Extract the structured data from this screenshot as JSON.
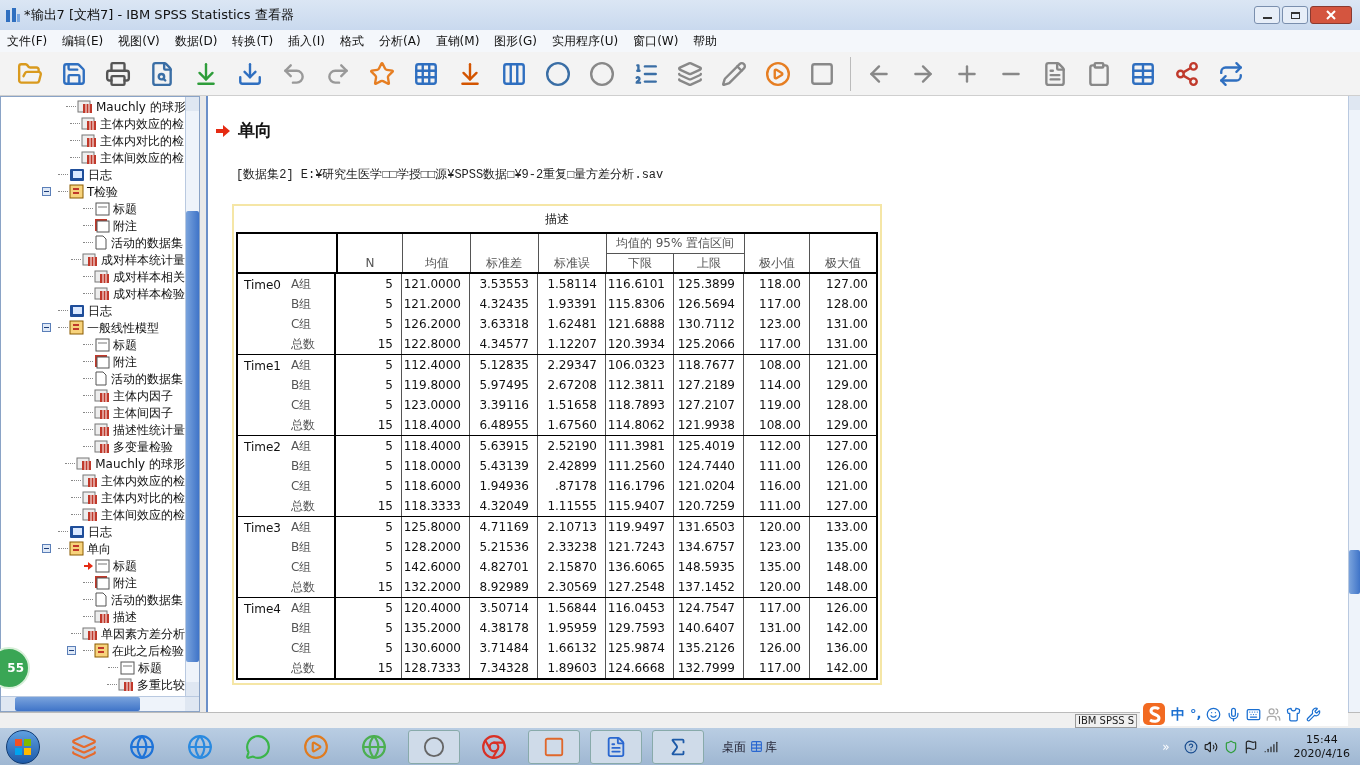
{
  "window": {
    "title": "*输出7 [文档7] - IBM SPSS Statistics 查看器"
  },
  "menu": [
    "文件(F)",
    "编辑(E)",
    "视图(V)",
    "数据(D)",
    "转换(T)",
    "插入(I)",
    "格式",
    "分析(A)",
    "直销(M)",
    "图形(G)",
    "实用程序(U)",
    "窗口(W)",
    "帮助"
  ],
  "tree": {
    "continued": [
      {
        "label": "Mauchly 的球形",
        "kind": "table",
        "current": false
      },
      {
        "label": "主体内效应的检",
        "kind": "table",
        "current": false
      },
      {
        "label": "主体内对比的检",
        "kind": "table",
        "current": false
      },
      {
        "label": "主体间效应的检",
        "kind": "table",
        "current": false
      }
    ],
    "nodes": [
      {
        "label": "日志",
        "kind": "log",
        "current": false
      },
      {
        "label": "T检验",
        "kind": "folder",
        "current": false,
        "expanded": true,
        "children": [
          {
            "label": "标题",
            "kind": "title",
            "current": false
          },
          {
            "label": "附注",
            "kind": "note",
            "current": false
          },
          {
            "label": "活动的数据集",
            "kind": "dataset",
            "current": false
          },
          {
            "label": "成对样本统计量",
            "kind": "table",
            "current": false
          },
          {
            "label": "成对样本相关",
            "kind": "table",
            "current": false
          },
          {
            "label": "成对样本检验",
            "kind": "table",
            "current": false
          }
        ]
      },
      {
        "label": "日志",
        "kind": "log",
        "current": false
      },
      {
        "label": "一般线性模型",
        "kind": "folder",
        "current": false,
        "expanded": true,
        "children": [
          {
            "label": "标题",
            "kind": "title",
            "current": false
          },
          {
            "label": "附注",
            "kind": "note",
            "current": false
          },
          {
            "label": "活动的数据集",
            "kind": "dataset",
            "current": false
          },
          {
            "label": "主体内因子",
            "kind": "table",
            "current": false
          },
          {
            "label": "主体间因子",
            "kind": "table",
            "current": false
          },
          {
            "label": "描述性统计量",
            "kind": "table",
            "current": false
          },
          {
            "label": "多变量检验",
            "kind": "table",
            "current": false
          },
          {
            "label": "Mauchly 的球形",
            "kind": "table",
            "current": false
          },
          {
            "label": "主体内效应的检",
            "kind": "table",
            "current": false
          },
          {
            "label": "主体内对比的检",
            "kind": "table",
            "current": false
          },
          {
            "label": "主体间效应的检",
            "kind": "table",
            "current": false
          }
        ]
      },
      {
        "label": "日志",
        "kind": "log",
        "current": false
      },
      {
        "label": "单向",
        "kind": "folder",
        "current": false,
        "expanded": true,
        "children": [
          {
            "label": "标题",
            "kind": "title",
            "current": true
          },
          {
            "label": "附注",
            "kind": "note",
            "current": false
          },
          {
            "label": "活动的数据集",
            "kind": "dataset",
            "current": false
          },
          {
            "label": "描述",
            "kind": "table",
            "current": false
          },
          {
            "label": "单因素方差分析",
            "kind": "table",
            "current": false
          },
          {
            "label": "在此之后检验",
            "kind": "folder",
            "current": false,
            "expanded": true,
            "children": [
              {
                "label": "标题",
                "kind": "title",
                "current": false
              },
              {
                "label": "多重比较",
                "kind": "table",
                "current": false
              }
            ]
          }
        ]
      }
    ]
  },
  "content": {
    "heading": "单向",
    "dataset_line": "[数据集2] E:¥研究生医学□□学授□□源¥SPSS数据□¥9-2重复□量方差分析.sav",
    "table": {
      "title": "描述",
      "columns": [
        "N",
        "均值",
        "标准差",
        "标准误",
        "下限",
        "上限",
        "极小值",
        "极大值"
      ],
      "ci_header": "均值的 95% 置信区间",
      "blocks": [
        {
          "label": "Time0",
          "rows": [
            [
              "A组",
              "5",
              "121.0000",
              "3.53553",
              "1.58114",
              "116.6101",
              "125.3899",
              "118.00",
              "127.00"
            ],
            [
              "B组",
              "5",
              "121.2000",
              "4.32435",
              "1.93391",
              "115.8306",
              "126.5694",
              "117.00",
              "128.00"
            ],
            [
              "C组",
              "5",
              "126.2000",
              "3.63318",
              "1.62481",
              "121.6888",
              "130.7112",
              "123.00",
              "131.00"
            ],
            [
              "总数",
              "15",
              "122.8000",
              "4.34577",
              "1.12207",
              "120.3934",
              "125.2066",
              "117.00",
              "131.00"
            ]
          ]
        },
        {
          "label": "Time1",
          "rows": [
            [
              "A组",
              "5",
              "112.4000",
              "5.12835",
              "2.29347",
              "106.0323",
              "118.7677",
              "108.00",
              "121.00"
            ],
            [
              "B组",
              "5",
              "119.8000",
              "5.97495",
              "2.67208",
              "112.3811",
              "127.2189",
              "114.00",
              "129.00"
            ],
            [
              "C组",
              "5",
              "123.0000",
              "3.39116",
              "1.51658",
              "118.7893",
              "127.2107",
              "119.00",
              "128.00"
            ],
            [
              "总数",
              "15",
              "118.4000",
              "6.48955",
              "1.67560",
              "114.8062",
              "121.9938",
              "108.00",
              "129.00"
            ]
          ]
        },
        {
          "label": "Time2",
          "rows": [
            [
              "A组",
              "5",
              "118.4000",
              "5.63915",
              "2.52190",
              "111.3981",
              "125.4019",
              "112.00",
              "127.00"
            ],
            [
              "B组",
              "5",
              "118.0000",
              "5.43139",
              "2.42899",
              "111.2560",
              "124.7440",
              "111.00",
              "126.00"
            ],
            [
              "C组",
              "5",
              "118.6000",
              "1.94936",
              ".87178",
              "116.1796",
              "121.0204",
              "116.00",
              "121.00"
            ],
            [
              "总数",
              "15",
              "118.3333",
              "4.32049",
              "1.11555",
              "115.9407",
              "120.7259",
              "111.00",
              "127.00"
            ]
          ]
        },
        {
          "label": "Time3",
          "rows": [
            [
              "A组",
              "5",
              "125.8000",
              "4.71169",
              "2.10713",
              "119.9497",
              "131.6503",
              "120.00",
              "133.00"
            ],
            [
              "B组",
              "5",
              "128.2000",
              "5.21536",
              "2.33238",
              "121.7243",
              "134.6757",
              "123.00",
              "135.00"
            ],
            [
              "C组",
              "5",
              "142.6000",
              "4.82701",
              "2.15870",
              "136.6065",
              "148.5935",
              "135.00",
              "148.00"
            ],
            [
              "总数",
              "15",
              "132.2000",
              "8.92989",
              "2.30569",
              "127.2548",
              "137.1452",
              "120.00",
              "148.00"
            ]
          ]
        },
        {
          "label": "Time4",
          "rows": [
            [
              "A组",
              "5",
              "120.4000",
              "3.50714",
              "1.56844",
              "116.0453",
              "124.7547",
              "117.00",
              "126.00"
            ],
            [
              "B组",
              "5",
              "135.2000",
              "4.38178",
              "1.95959",
              "129.7593",
              "140.6407",
              "131.00",
              "142.00"
            ],
            [
              "C组",
              "5",
              "130.6000",
              "3.71484",
              "1.66132",
              "125.9874",
              "135.2126",
              "126.00",
              "136.00"
            ],
            [
              "总数",
              "15",
              "128.7333",
              "7.34328",
              "1.89603",
              "124.6668",
              "132.7999",
              "117.00",
              "142.00"
            ]
          ]
        }
      ]
    }
  },
  "floating_badge": "55",
  "status_bar": {
    "text": "IBM SPSS S"
  },
  "ime": {
    "mode": "中",
    "punctuation": "°,"
  },
  "taskbar": {
    "toolbar_label": "桌面",
    "library_label": "库",
    "overflow": "»",
    "time": "15:44",
    "date": "2020/4/16"
  }
}
